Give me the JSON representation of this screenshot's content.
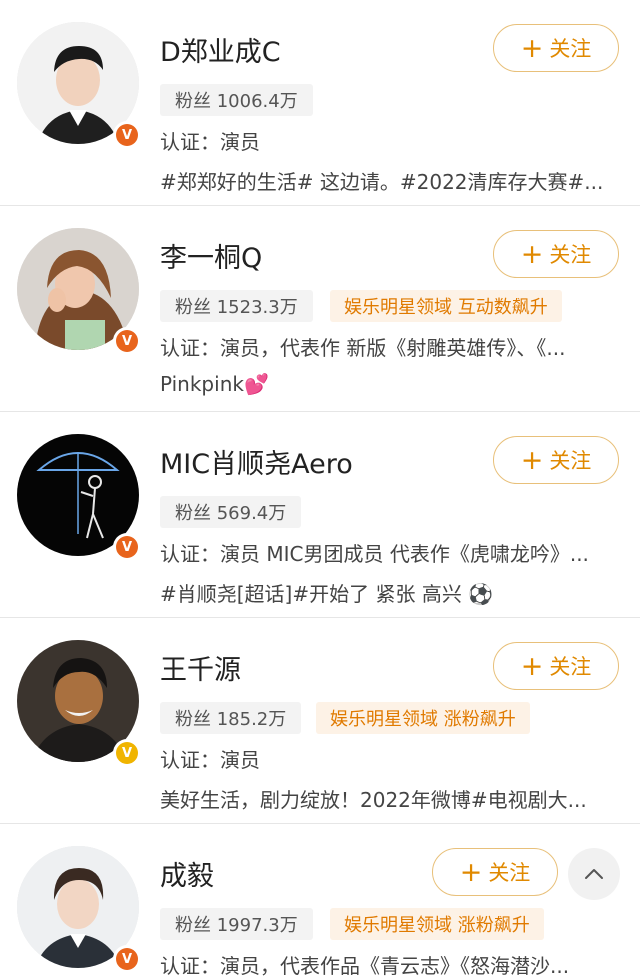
{
  "follow_label": "关注",
  "users": [
    {
      "name": "D郑业成C",
      "fans": "粉丝 1006.4万",
      "tag": "",
      "auth": "认证：演员",
      "desc": "#郑郑好的生活# 这边请。#2022清库存大赛#...",
      "badge_color": "#e8641c"
    },
    {
      "name": "李一桐Q",
      "fans": "粉丝 1523.3万",
      "tag": "娱乐明星领域 互动数飙升",
      "auth": "认证：演员，代表作 新版《射雕英雄传》、《...",
      "desc": "Pinkpink💕",
      "badge_color": "#e8641c"
    },
    {
      "name": "MIC肖顺尧Aero",
      "fans": "粉丝 569.4万",
      "tag": "",
      "auth": "认证：演员 MIC男团成员 代表作《虎啸龙吟》...",
      "desc": "#肖顺尧[超话]#开始了 紧张 高兴 ⚽",
      "badge_color": "#e8641c"
    },
    {
      "name": "王千源",
      "fans": "粉丝 185.2万",
      "tag": "娱乐明星领域 涨粉飙升",
      "auth": "认证：演员",
      "desc": "美好生活，剧力绽放！2022年微博#电视剧大...",
      "badge_color": "#f0b400"
    },
    {
      "name": "成毅",
      "fans": "粉丝 1997.3万",
      "tag": "娱乐明星领域 涨粉飙升",
      "auth": "认证：演员，代表作品《青云志》《怒海潜沙...",
      "desc": "",
      "badge_color": "#e8641c"
    }
  ],
  "icons": {
    "verified": "verified-v-icon",
    "plus": "plus-icon",
    "scroll_top": "chevron-up-icon"
  }
}
